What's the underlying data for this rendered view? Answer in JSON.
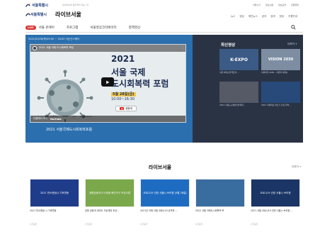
{
  "top": {
    "logo": "서울특별시",
    "tagline": "세나와이네 꿈꾸을이 되는, 안",
    "links": [
      "서울소식",
      "정보소통",
      "정보공개",
      "민원행정"
    ]
  },
  "header": {
    "brand": "서울특별시",
    "title": "라이브서울",
    "util": [
      "뉴스",
      "영상",
      "메인뉴스",
      "공지",
      "검색",
      "방송",
      "이용안내"
    ]
  },
  "nav": {
    "live_label": "LIVE",
    "items": [
      "서울 온에어",
      "프로그램",
      "서울영상크리에이터",
      "정책영상"
    ]
  },
  "hero": {
    "player_header": "2021/05/28(목)09:50 ~ 18:00 이순신스퀘어",
    "video_title": "2021 서울 국제 도시회복력 포럼",
    "poster": {
      "year": "2021",
      "line1": "서울 국제",
      "line2": "도시회복력 포럼",
      "date": "5월 28일(금)",
      "time": "10:00~16:30",
      "youtube": "생중계"
    },
    "sponsors": [
      "서울특별시",
      "ICLEI",
      "UN",
      "World Bank"
    ],
    "watch_on": "다음에서 보기",
    "youtube_word": "YouTube",
    "caption": "2021 서울국제도시회복력포럼",
    "recent_title": "최신영상",
    "more": "더보기 +",
    "recent": [
      {
        "caption": "서울 파이브커넥트의 ...",
        "tone": "#3b5a86",
        "label": "K-EXPO"
      },
      {
        "caption": "서울비전 2030 - 서울의 미래는",
        "tone": "#7d8ea3",
        "label": "VISION 2030"
      },
      {
        "caption": "2021 서울도시재생기본계획...",
        "tone": "#555a66",
        "label": ""
      },
      {
        "caption": "2021 서울의료 파트가 가정 지역...",
        "tone": "#274a7a",
        "label": ""
      }
    ]
  },
  "lower": {
    "title": "라이브서울",
    "more": "더보기 +",
    "cards": [
      {
        "title": "2021 반소증점 시 기후변동",
        "meta": "다른등록",
        "tone": "#1f3c8a",
        "label": "2021 반소증점시 기후변동"
      },
      {
        "title": "공원 공동개 대국도 가로계획 조성...",
        "meta": "다른등록",
        "tone": "#7aa84a",
        "label": "공원공동개 도시재생 확인지구 조성사업"
      },
      {
        "title": "2021년 국제 서울 코로나19 공조를 ...",
        "meta": "다른등록",
        "tone": "#1e6cc1",
        "label": "코로나19 관련 서울시 브리핑 (9월 28일)"
      },
      {
        "title": "2022 서울 국제도시회복력 포",
        "meta": "다른등록",
        "tone": "#3a6d9f",
        "label": ""
      },
      {
        "title": "2021 서울 코로나19 관련 서울시 브리핑 ...",
        "meta": "다른등록",
        "tone": "#1a3566",
        "label": "코로나19 관련 서울시 브리핑"
      }
    ]
  },
  "colors": {
    "hero_left": "#2b6fae",
    "hero_right": "#2a3344",
    "live_pill": "#d9322e",
    "navy": "#1b2c4f"
  }
}
